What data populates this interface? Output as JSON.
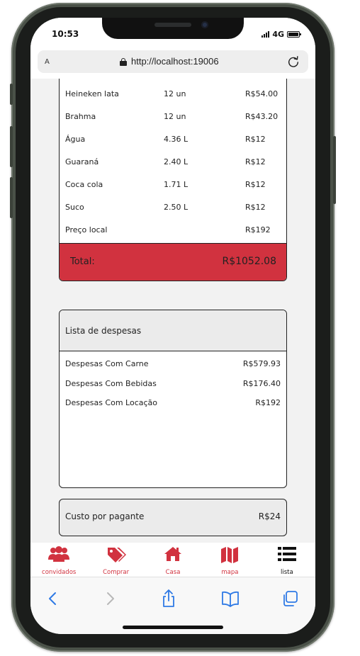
{
  "status_bar": {
    "time": "10:53",
    "network": "4G"
  },
  "browser": {
    "text_size_label": "A",
    "url": "http://localhost:19006"
  },
  "orders": {
    "rows": [
      {
        "name": "Heineken lata",
        "qty": "12 un",
        "price": "R$54.00"
      },
      {
        "name": "Brahma",
        "qty": "12 un",
        "price": "R$43.20"
      },
      {
        "name": "Água",
        "qty": "4.36 L",
        "price": "R$12"
      },
      {
        "name": "Guaraná",
        "qty": "2.40 L",
        "price": "R$12"
      },
      {
        "name": "Coca cola",
        "qty": "1.71 L",
        "price": "R$12"
      },
      {
        "name": "Suco",
        "qty": "2.50 L",
        "price": "R$12"
      },
      {
        "name": "Preço local",
        "qty": "",
        "price": "R$192"
      }
    ],
    "total_label": "Total:",
    "total_value": "R$1052.08"
  },
  "expenses": {
    "title": "Lista de despesas",
    "rows": [
      {
        "name": "Despesas Com Carne",
        "value": "R$579.93"
      },
      {
        "name": "Despesas Com Bebidas",
        "value": "R$176.40"
      },
      {
        "name": "Despesas Com Locação",
        "value": "R$192"
      }
    ]
  },
  "cost_per_payer": {
    "label": "Custo por pagante",
    "value": "R$24"
  },
  "app_nav": {
    "items": [
      {
        "label": "convidados",
        "icon": "users-icon"
      },
      {
        "label": "Comprar",
        "icon": "tags-icon"
      },
      {
        "label": "Casa",
        "icon": "home-icon"
      },
      {
        "label": "mapa",
        "icon": "map-icon"
      },
      {
        "label": "lista",
        "icon": "list-icon"
      }
    ],
    "active_index": 4
  },
  "colors": {
    "accent": "#d1323f",
    "page_bg": "#f2f2f2",
    "card_header": "#ebebeb",
    "ios_blue": "#2f7ae5"
  }
}
